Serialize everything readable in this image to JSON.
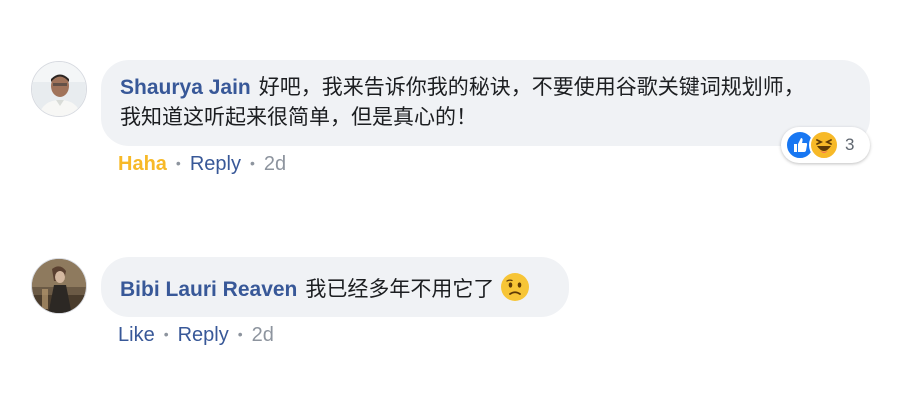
{
  "comments": [
    {
      "author": "Shaurya Jain",
      "text_line1": "好吧，我来告诉你我的秘诀，不要使用谷歌关键词规划师，",
      "text_line2": "我知道这听起来很简单，但是真心的！",
      "reaction_action": "Haha",
      "reply_label": "Reply",
      "time": "2d",
      "reactions": {
        "icons": [
          "like-icon",
          "haha-icon"
        ],
        "count": "3"
      }
    },
    {
      "author": "Bibi Lauri Reaven",
      "text": "我已经多年不用它了",
      "emoji": "confused-face-icon",
      "like_label": "Like",
      "reply_label": "Reply",
      "time": "2d"
    }
  ],
  "colors": {
    "author_link": "#385898",
    "bubble_bg": "#f0f2f5",
    "haha_yellow": "#f7b928",
    "like_blue": "#1877f2",
    "meta_gray": "#8d949e"
  }
}
